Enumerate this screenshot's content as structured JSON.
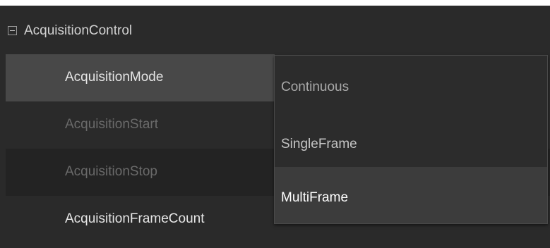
{
  "group": {
    "title": "AcquisitionControl",
    "icon": "collapse-minus-icon"
  },
  "features": [
    {
      "label": "AcquisitionMode",
      "state": "selected"
    },
    {
      "label": "AcquisitionStart",
      "state": "disabled"
    },
    {
      "label": "AcquisitionStop",
      "state": "disabled"
    },
    {
      "label": "AcquisitionFrameCount",
      "state": "normal"
    }
  ],
  "dropdown": {
    "options": [
      "Continuous",
      "SingleFrame",
      "MultiFrame"
    ],
    "hovered": "MultiFrame"
  },
  "colors": {
    "panel_bg": "#2a2a2a",
    "selected_row": "#484848",
    "hover_item": "#3c3c3c"
  }
}
